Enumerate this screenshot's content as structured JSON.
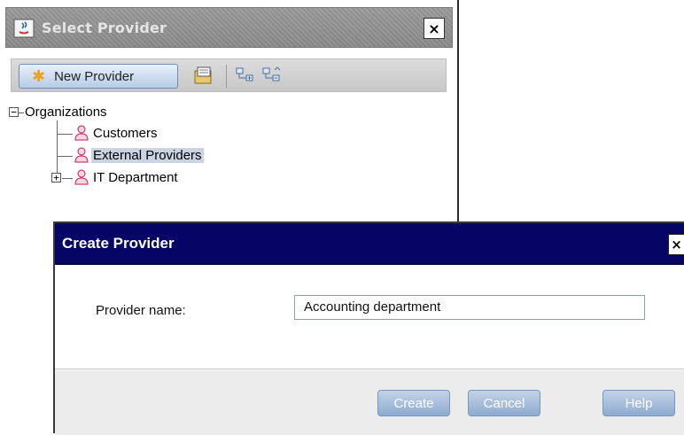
{
  "select_provider": {
    "title": "Select Provider",
    "close_glyph": "×",
    "toolbar": {
      "new_provider_label": "New Provider",
      "icons": [
        "new-star-icon",
        "properties-icon",
        "expand-all-icon",
        "collapse-all-icon"
      ]
    },
    "tree": {
      "root": {
        "label": "Organizations",
        "expander": "−"
      },
      "children": [
        {
          "label": "Customers",
          "selected": false
        },
        {
          "label": "External Providers",
          "selected": true
        },
        {
          "label": "IT Department",
          "expander": "+",
          "selected": false
        }
      ]
    }
  },
  "create_provider": {
    "title": "Create Provider",
    "close_glyph": "×",
    "field_label": "Provider name:",
    "field_value": "Accounting department",
    "buttons": {
      "create": "Create",
      "cancel": "Cancel",
      "help": "Help"
    }
  },
  "colors": {
    "dialog_titlebar": "#050566",
    "selection": "#c9d3e2",
    "button_gradient_top": "#c3d3e8",
    "button_gradient_bottom": "#8eabd0"
  }
}
